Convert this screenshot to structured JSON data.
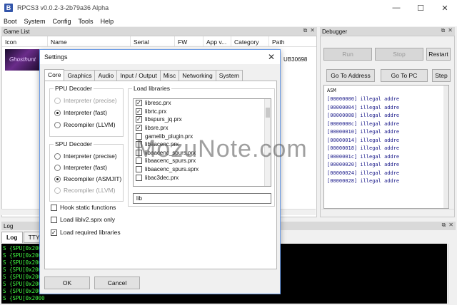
{
  "window": {
    "title": "RPCS3 v0.0.2-3-2b79a36 Alpha",
    "controls": [
      "—",
      "☐",
      "✕"
    ]
  },
  "menu": [
    "Boot",
    "System",
    "Config",
    "Tools",
    "Help"
  ],
  "game_list": {
    "title": "Game List",
    "columns": [
      "Icon",
      "Name",
      "Serial",
      "FW",
      "App v...",
      "Category",
      "Path"
    ],
    "rows": [
      {
        "serial_partial": "UB30698",
        "icon_text": "Ghosthunt"
      }
    ]
  },
  "debugger": {
    "title": "Debugger",
    "buttons": {
      "run": "Run",
      "stop": "Stop",
      "restart": "Restart",
      "goto_address": "Go To Address",
      "goto_pc": "Go To PC",
      "step": "Step"
    },
    "asm_title": "ASM",
    "asm_lines": [
      "[00000000] illegal addre",
      "[00000004] illegal addre",
      "[00000008] illegal addre",
      "[0000000c] illegal addre",
      "[00000010] illegal addre",
      "[00000014] illegal addre",
      "[00000018] illegal addre",
      "[0000001c] illegal addre",
      "[00000020] illegal addre",
      "[00000024] illegal addre",
      "[00000028] illegal addre"
    ]
  },
  "log": {
    "title": "Log",
    "tabs": [
      "Log",
      "TTY"
    ],
    "lines": [
      "S {SPU[0x2000",
      "S {SPU[0x2000",
      "S {SPU[0x2000",
      "S {SPU[0x2000",
      "S {SPU[0x2000",
      "S {SPU[0x2000",
      "S {SPU[0x2000",
      "S {SPU[0x2000"
    ]
  },
  "settings": {
    "title": "Settings",
    "tabs": [
      "Core",
      "Graphics",
      "Audio",
      "Input / Output",
      "Misc",
      "Networking",
      "System"
    ],
    "active_tab": "Core",
    "ppu": {
      "title": "PPU Decoder",
      "options": [
        {
          "label": "Interpreter (precise)",
          "checked": false,
          "disabled": true
        },
        {
          "label": "Interpreter (fast)",
          "checked": true,
          "disabled": false
        },
        {
          "label": "Recompiler (LLVM)",
          "checked": false,
          "disabled": false
        }
      ]
    },
    "spu": {
      "title": "SPU Decoder",
      "options": [
        {
          "label": "Interpreter (precise)",
          "checked": false,
          "disabled": false
        },
        {
          "label": "Interpreter (fast)",
          "checked": false,
          "disabled": false
        },
        {
          "label": "Recompiler (ASMJIT)",
          "checked": true,
          "disabled": false
        },
        {
          "label": "Recompiler (LLVM)",
          "checked": false,
          "disabled": true
        }
      ]
    },
    "libraries": {
      "title": "Load libraries",
      "items": [
        {
          "label": "libresc.prx",
          "checked": true
        },
        {
          "label": "librtc.prx",
          "checked": true
        },
        {
          "label": "libspurs_jq.prx",
          "checked": true
        },
        {
          "label": "libsre.prx",
          "checked": true
        },
        {
          "label": "gamelib_plugin.prx",
          "checked": false
        },
        {
          "label": "libaacenc.prx",
          "checked": false
        },
        {
          "label": "libaacenc_spurs.prx",
          "checked": false
        },
        {
          "label": "libaacenc_spurs.prx",
          "checked": false
        },
        {
          "label": "libaacenc_spurs.sprx",
          "checked": false
        },
        {
          "label": "libac3dec.prx",
          "checked": false
        }
      ],
      "filter_value": "lib"
    },
    "checkboxes": [
      {
        "label": "Hook static functions",
        "checked": false
      },
      {
        "label": "Load liblv2.sprx only",
        "checked": false
      },
      {
        "label": "Load required libraries",
        "checked": true
      }
    ],
    "buttons": {
      "ok": "OK",
      "cancel": "Cancel"
    }
  },
  "watermark": "MozuNote.com"
}
